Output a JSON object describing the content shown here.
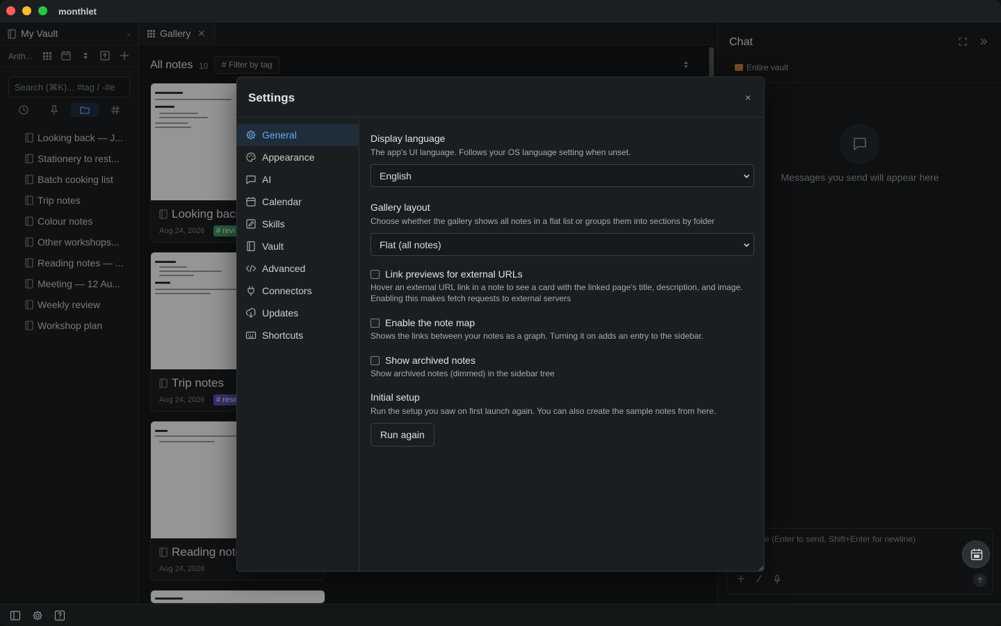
{
  "app": {
    "title": "monthlet"
  },
  "sidebar": {
    "vault_name": "My Vault",
    "tool_label": "Anth...",
    "search_placeholder": "Search (⌘K)... #tag / -#e",
    "notes": [
      "Looking back — J...",
      "Stationery to rest...",
      "Batch cooking list",
      "Trip notes",
      "Colour notes",
      "Other workshops...",
      "Reading notes — ...",
      "Meeting — 12 Au...",
      "Weekly review",
      "Workshop plan"
    ]
  },
  "tabs": [
    {
      "label": "Gallery"
    }
  ],
  "gallery": {
    "title": "All notes",
    "count": "10",
    "filter_label": "# Filter by tag",
    "cards": [
      {
        "title": "Looking back",
        "date": "Aug 24, 2026",
        "tag": "# revi",
        "tag_color": "#3f8f5a"
      },
      {
        "title": "Trip notes",
        "date": "Aug 24, 2026",
        "tag": "# rese",
        "tag_color": "#5a4fa8"
      },
      {
        "title": "Reading notes",
        "date": "Aug 24, 2026",
        "tag": "",
        "tag_color": ""
      }
    ]
  },
  "chat": {
    "title": "Chat",
    "scope": "Entire vault",
    "empty_message": "Messages you send will appear here",
    "input_placeholder": "message (Enter to send, Shift+Enter for newline)"
  },
  "settings": {
    "title": "Settings",
    "close_label": "×",
    "nav": [
      {
        "label": "General",
        "icon": "gear-icon",
        "active": true
      },
      {
        "label": "Appearance",
        "icon": "palette-icon"
      },
      {
        "label": "AI",
        "icon": "chat-bubble-icon"
      },
      {
        "label": "Calendar",
        "icon": "calendar-icon"
      },
      {
        "label": "Skills",
        "icon": "pencil-square-icon"
      },
      {
        "label": "Vault",
        "icon": "notebook-icon"
      },
      {
        "label": "Advanced",
        "icon": "code-icon"
      },
      {
        "label": "Connectors",
        "icon": "plug-icon"
      },
      {
        "label": "Updates",
        "icon": "download-icon"
      },
      {
        "label": "Shortcuts",
        "icon": "keyboard-icon"
      }
    ],
    "general": {
      "display_language": {
        "title": "Display language",
        "desc": "The app's UI language. Follows your OS language setting when unset.",
        "value": "English"
      },
      "gallery_layout": {
        "title": "Gallery layout",
        "desc": "Choose whether the gallery shows all notes in a flat list or groups them into sections by folder",
        "value": "Flat (all notes)"
      },
      "link_previews": {
        "label": "Link previews for external URLs",
        "desc": "Hover an external URL link in a note to see a card with the linked page's title, description, and image. Enabling this makes fetch requests to external servers",
        "checked": false
      },
      "note_map": {
        "label": "Enable the note map",
        "desc": "Shows the links between your notes as a graph. Turning it on adds an entry to the sidebar.",
        "checked": false
      },
      "archived": {
        "label": "Show archived notes",
        "desc": "Show archived notes (dimmed) in the sidebar tree",
        "checked": false
      },
      "initial_setup": {
        "title": "Initial setup",
        "desc": "Run the setup you saw on first launch again. You can also create the sample notes from here.",
        "button": "Run again"
      }
    }
  },
  "colors": {
    "accent": "#5b9ddc",
    "traffic_red": "#fe5f57",
    "traffic_yellow": "#febc2e",
    "traffic_green": "#28c840"
  }
}
